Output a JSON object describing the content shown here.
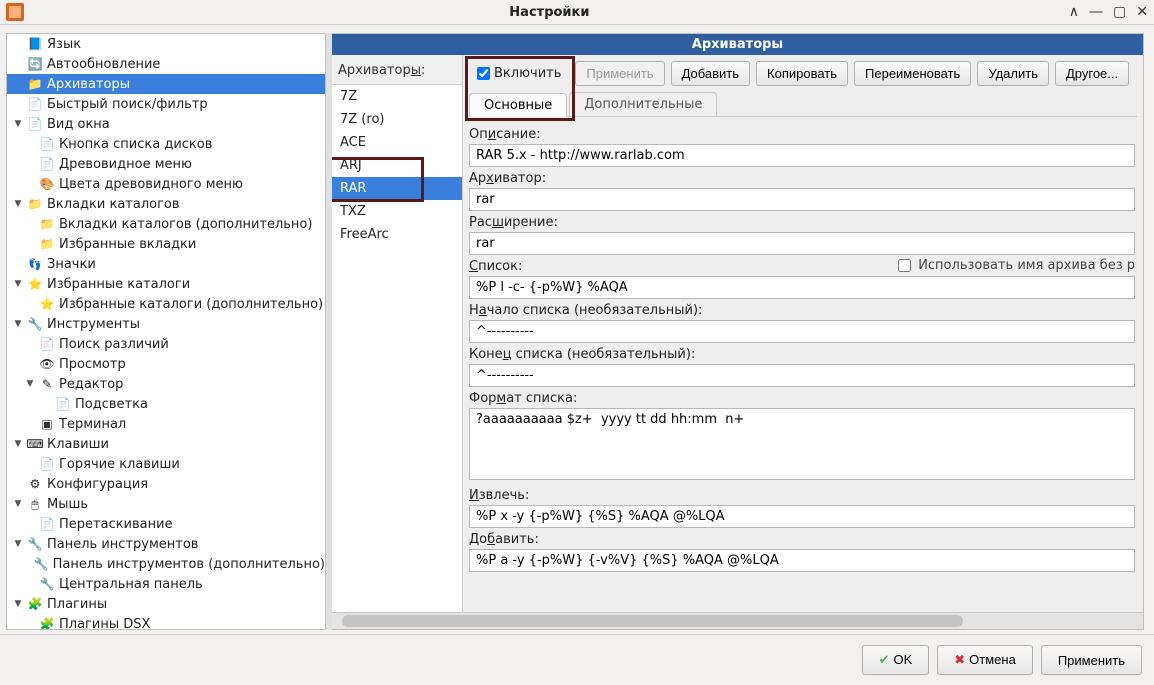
{
  "window": {
    "title": "Настройки"
  },
  "tree": [
    {
      "label": "Язык",
      "icon": "ico-lang"
    },
    {
      "label": "Автообновление",
      "icon": "ico-upd"
    },
    {
      "label": "Архиваторы",
      "icon": "ico-folder",
      "selected": true
    },
    {
      "label": "Быстрый поиск/фильтр",
      "icon": "ico-page"
    },
    {
      "label": "Вид окна",
      "icon": "ico-page",
      "expand": "▼",
      "children": [
        {
          "label": "Кнопка списка дисков",
          "icon": "ico-page"
        },
        {
          "label": "Древовидное меню",
          "icon": "ico-page"
        },
        {
          "label": "Цвета древовидного меню",
          "icon": "ico-color"
        }
      ]
    },
    {
      "label": "Вкладки каталогов",
      "icon": "ico-folder",
      "expand": "▼",
      "children": [
        {
          "label": "Вкладки каталогов (дополнительно)",
          "icon": "ico-folder"
        },
        {
          "label": "Избранные вкладки",
          "icon": "ico-folder"
        }
      ]
    },
    {
      "label": "Значки",
      "icon": "ico-feet"
    },
    {
      "label": "Избранные каталоги",
      "icon": "ico-star",
      "expand": "▼",
      "children": [
        {
          "label": "Избранные каталоги (дополнительно)",
          "icon": "ico-star"
        }
      ]
    },
    {
      "label": "Инструменты",
      "icon": "ico-tool",
      "expand": "▼",
      "children": [
        {
          "label": "Поиск различий",
          "icon": "ico-page"
        },
        {
          "label": "Просмотр",
          "icon": "ico-eye"
        },
        {
          "label": "Редактор",
          "icon": "ico-edit",
          "expand": "▼",
          "children": [
            {
              "label": "Подсветка",
              "icon": "ico-page"
            }
          ]
        },
        {
          "label": "Терминал",
          "icon": "ico-term"
        }
      ]
    },
    {
      "label": "Клавиши",
      "icon": "ico-key",
      "expand": "▼",
      "children": [
        {
          "label": "Горячие клавиши",
          "icon": "ico-page"
        }
      ]
    },
    {
      "label": "Конфигурация",
      "icon": "ico-gear"
    },
    {
      "label": "Мышь",
      "icon": "ico-mouse",
      "expand": "▼",
      "children": [
        {
          "label": "Перетаскивание",
          "icon": "ico-page"
        }
      ]
    },
    {
      "label": "Панель инструментов",
      "icon": "ico-tool",
      "expand": "▼",
      "children": [
        {
          "label": "Панель инструментов (дополнительно)",
          "icon": "ico-tool"
        },
        {
          "label": "Центральная панель",
          "icon": "ico-tool"
        }
      ]
    },
    {
      "label": "Плагины",
      "icon": "ico-puzzle",
      "expand": "▼",
      "children": [
        {
          "label": "Плагины DSX",
          "icon": "ico-puzzle"
        }
      ]
    }
  ],
  "right": {
    "header": "Архиваторы",
    "listLabel": "Архиваторы:",
    "list": [
      "7Z",
      "7Z (ro)",
      "ACE",
      "ARJ",
      "RAR",
      "TXZ",
      "FreeArc"
    ],
    "selected": "RAR",
    "enable": {
      "label": "Включить",
      "checked": true
    },
    "buttons": {
      "apply": "Применить",
      "add": "Добавить",
      "copy": "Копировать",
      "rename": "Переименовать",
      "delete": "Удалить",
      "more": "Другое..."
    },
    "tabs": {
      "main": "Основные",
      "extra": "Дополнительные"
    },
    "fields": {
      "desc_label": "Описание:",
      "desc": "RAR 5.x - http://www.rarlab.com",
      "archiver_label": "Архиватор:",
      "archiver": "rar",
      "ext_label": "Расширение:",
      "ext": "rar",
      "list_label": "Список:",
      "list": "%P l -c- {-p%W} %AQA",
      "list_use_name": "Использовать имя архива без р",
      "list_start_label": "Начало списка (необязательный):",
      "list_start": "^----------",
      "list_end_label": "Конец списка (необязательный):",
      "list_end": "^----------",
      "format_label": "Формат списка:",
      "format": "?aaaaaaaaaa $z+  yyyy tt dd hh:mm  n+",
      "extract_label": "Извлечь:",
      "extract": "%P x -y {-p%W} {%S} %AQA @%LQA",
      "add_label": "Добавить:",
      "add": "%P a -y {-p%W} {-v%V} {%S} %AQA @%LQA"
    }
  },
  "footer": {
    "ok": "OK",
    "cancel": "Отмена",
    "apply": "Применить"
  }
}
